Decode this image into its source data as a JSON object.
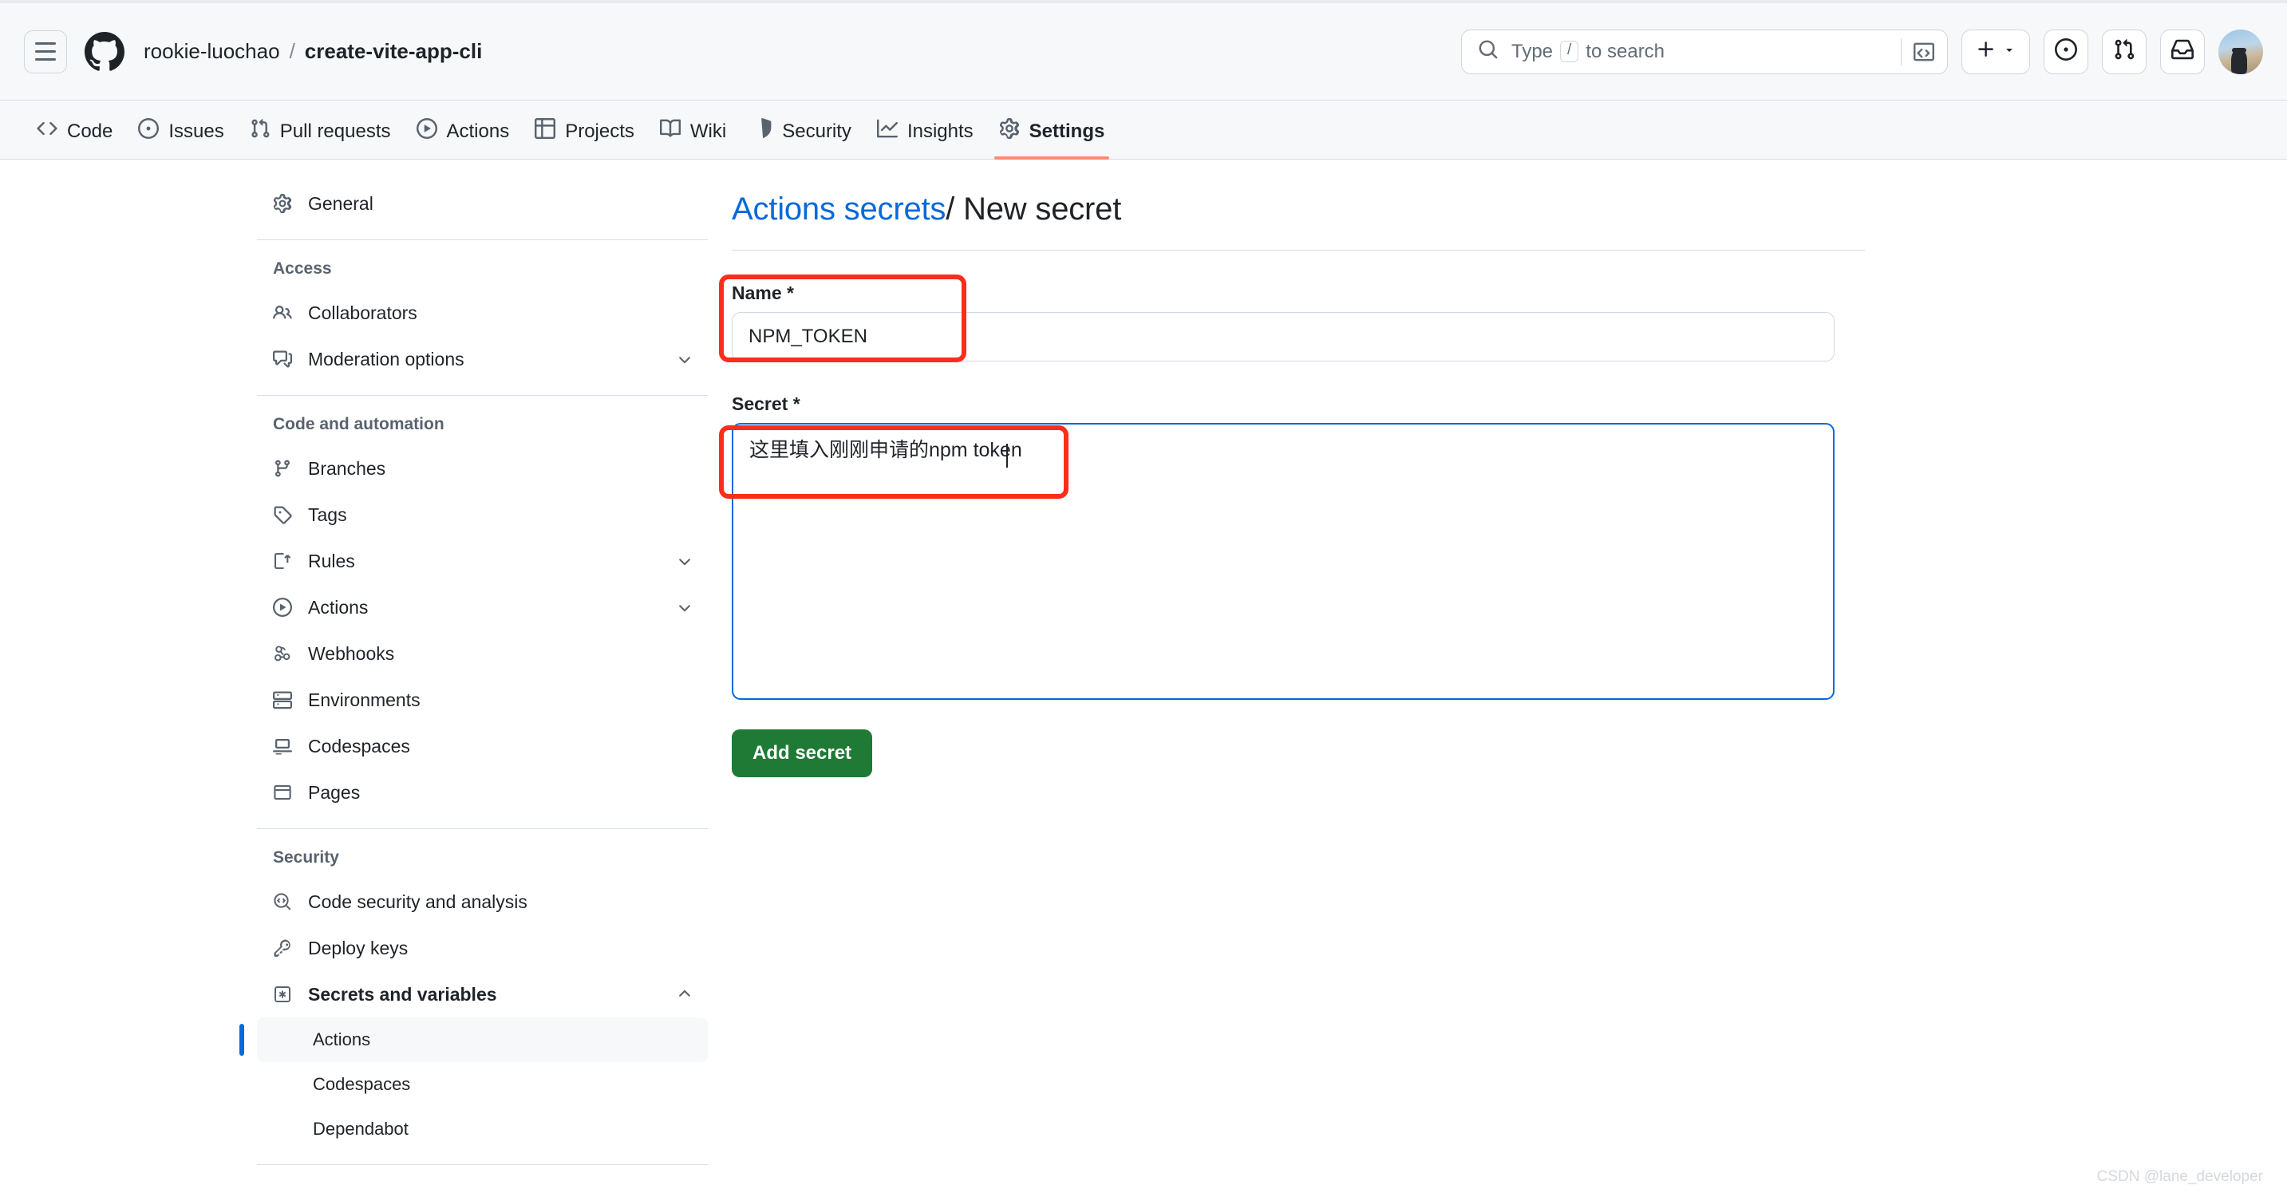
{
  "header": {
    "menu_icon": "hamburger-icon",
    "logo_icon": "github-logo-icon",
    "owner": "rookie-luochao",
    "separator": "/",
    "repo": "create-vite-app-cli",
    "search": {
      "icon": "search-icon",
      "placeholder_prefix": "Type",
      "slash_key": "/",
      "placeholder_suffix": "to search",
      "command_icon": "command-palette-icon"
    },
    "actions": [
      {
        "name": "create-new-button",
        "icon": "plus-icon",
        "has_dropdown": true
      },
      {
        "name": "issues-button",
        "icon": "issue-opened-icon"
      },
      {
        "name": "pull-requests-button",
        "icon": "git-pull-request-icon"
      },
      {
        "name": "notifications-button",
        "icon": "inbox-icon"
      },
      {
        "name": "user-avatar",
        "icon": "avatar-image"
      }
    ]
  },
  "repo_nav": {
    "tabs": [
      {
        "label": "Code",
        "icon": "code-icon",
        "active": false
      },
      {
        "label": "Issues",
        "icon": "issue-opened-icon",
        "active": false
      },
      {
        "label": "Pull requests",
        "icon": "git-pull-request-icon",
        "active": false
      },
      {
        "label": "Actions",
        "icon": "play-icon",
        "active": false
      },
      {
        "label": "Projects",
        "icon": "table-icon",
        "active": false
      },
      {
        "label": "Wiki",
        "icon": "book-icon",
        "active": false
      },
      {
        "label": "Security",
        "icon": "shield-icon",
        "active": false
      },
      {
        "label": "Insights",
        "icon": "graph-icon",
        "active": false
      },
      {
        "label": "Settings",
        "icon": "gear-icon",
        "active": true
      }
    ],
    "active_underline_color": "#fd8c73"
  },
  "sidebar": {
    "general": {
      "label": "General",
      "icon": "gear-icon"
    },
    "groups": [
      {
        "title": "Access",
        "items": [
          {
            "label": "Collaborators",
            "icon": "people-icon",
            "chevron": null
          },
          {
            "label": "Moderation options",
            "icon": "comment-discussion-icon",
            "chevron": "chevron-down-icon"
          }
        ]
      },
      {
        "title": "Code and automation",
        "items": [
          {
            "label": "Branches",
            "icon": "git-branch-icon",
            "chevron": null
          },
          {
            "label": "Tags",
            "icon": "tag-icon",
            "chevron": null
          },
          {
            "label": "Rules",
            "icon": "rules-icon",
            "chevron": "chevron-down-icon"
          },
          {
            "label": "Actions",
            "icon": "play-icon",
            "chevron": "chevron-down-icon"
          },
          {
            "label": "Webhooks",
            "icon": "webhook-icon",
            "chevron": null
          },
          {
            "label": "Environments",
            "icon": "server-icon",
            "chevron": null
          },
          {
            "label": "Codespaces",
            "icon": "codespaces-icon",
            "chevron": null
          },
          {
            "label": "Pages",
            "icon": "browser-icon",
            "chevron": null
          }
        ]
      },
      {
        "title": "Security",
        "items": [
          {
            "label": "Code security and analysis",
            "icon": "code-search-icon",
            "chevron": null
          },
          {
            "label": "Deploy keys",
            "icon": "key-icon",
            "chevron": null
          },
          {
            "label": "Secrets and variables",
            "icon": "asterisk-box-icon",
            "chevron": "chevron-up-icon",
            "bold": true
          }
        ],
        "sub_items": [
          {
            "label": "Actions",
            "selected": true
          },
          {
            "label": "Codespaces",
            "selected": false
          },
          {
            "label": "Dependabot",
            "selected": false
          }
        ]
      }
    ],
    "selected_indicator_color": "#0969da"
  },
  "main": {
    "title": {
      "link": "Actions secrets",
      "separator": "/",
      "current": "New secret"
    },
    "name_field": {
      "label": "Name *",
      "value": "NPM_TOKEN",
      "placeholder": ""
    },
    "secret_field": {
      "label": "Secret *",
      "value": "这里填入刚刚申请的npm token",
      "placeholder": "",
      "focused": true,
      "focus_color": "#0969da"
    },
    "submit_button": {
      "label": "Add secret",
      "color": "#1f7a36"
    },
    "annotations": {
      "color": "#fc2d1b",
      "boxes": [
        "name-field-highlight",
        "secret-field-highlight"
      ]
    }
  },
  "watermark": "CSDN @lane_developer"
}
